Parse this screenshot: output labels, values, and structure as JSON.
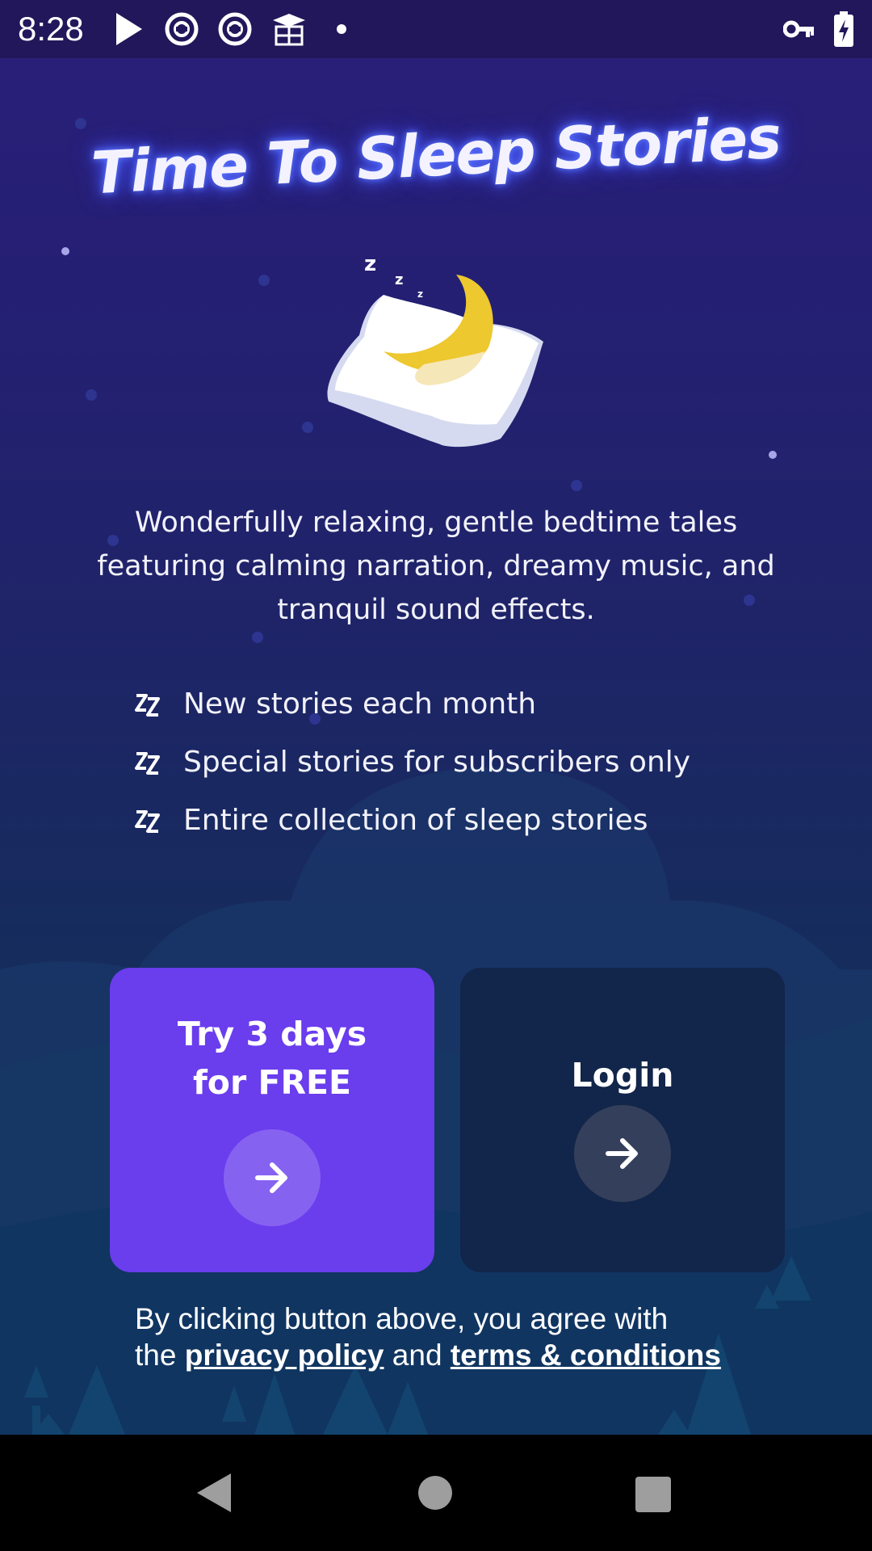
{
  "status_bar": {
    "time": "8:28",
    "icons": [
      "play-store-icon",
      "sync-icon",
      "sync-icon",
      "graduation-cap-icon",
      "notification-dot-icon",
      "vpn-key-icon",
      "battery-charging-icon"
    ]
  },
  "header": {
    "title": "Time To Sleep Stories",
    "illustration": "sleeping-moon-pillow-icon"
  },
  "description": "Wonderfully relaxing, gentle bedtime tales featuring calming narration, dreamy music, and tranquil sound effects.",
  "features": [
    {
      "label": "New stories each month",
      "icon": "zz-icon"
    },
    {
      "label": "Special stories for subscribers only",
      "icon": "zz-icon"
    },
    {
      "label": "Entire collection of sleep stories",
      "icon": "zz-icon"
    }
  ],
  "actions": {
    "trial": {
      "label_line1": "Try 3 days",
      "label_line2": "for FREE",
      "icon": "arrow-right-icon",
      "color": "#6a3ded"
    },
    "login": {
      "label": "Login",
      "icon": "arrow-right-icon",
      "color": "#12254a"
    }
  },
  "legal": {
    "prefix": "By clicking button above, you agree with",
    "the": "the",
    "privacy_link": "privacy policy",
    "and": "and",
    "terms_link": "terms & conditions"
  },
  "nav_bar": {
    "back": "back-icon",
    "home": "home-icon",
    "recents": "recents-icon"
  },
  "colors": {
    "background_top": "#2a1f7a",
    "background_bottom": "#0d3056",
    "title_glow": "#4a5cff",
    "moon": "#edc82e"
  }
}
